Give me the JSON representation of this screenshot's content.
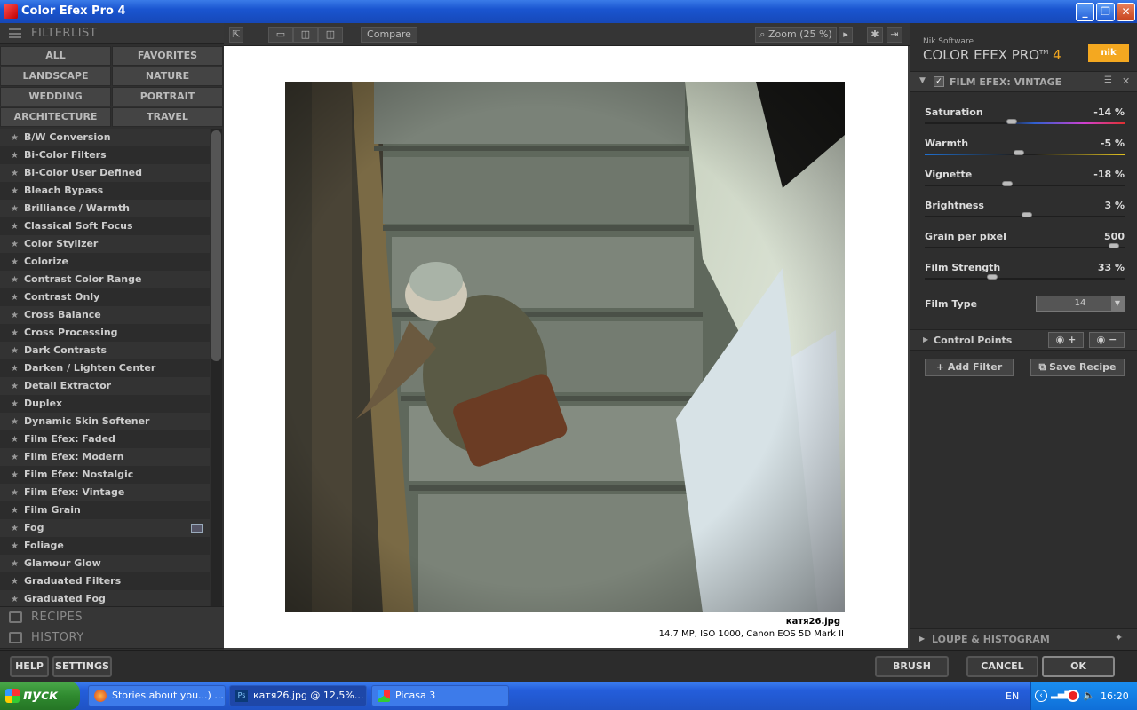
{
  "window": {
    "title": "Color Efex Pro 4"
  },
  "left": {
    "filterlist_label": "FILTERLIST",
    "categories": [
      "ALL",
      "FAVORITES",
      "LANDSCAPE",
      "NATURE",
      "WEDDING",
      "PORTRAIT",
      "ARCHITECTURE",
      "TRAVEL"
    ],
    "filters": [
      "B/W Conversion",
      "Bi-Color Filters",
      "Bi-Color User Defined",
      "Bleach Bypass",
      "Brilliance / Warmth",
      "Classical Soft Focus",
      "Color Stylizer",
      "Colorize",
      "Contrast Color Range",
      "Contrast Only",
      "Cross Balance",
      "Cross Processing",
      "Dark Contrasts",
      "Darken / Lighten Center",
      "Detail Extractor",
      "Duplex",
      "Dynamic Skin Softener",
      "Film Efex: Faded",
      "Film Efex: Modern",
      "Film Efex: Nostalgic",
      "Film Efex: Vintage",
      "Film Grain",
      "Fog",
      "Foliage",
      "Glamour Glow",
      "Graduated Filters",
      "Graduated Fog"
    ],
    "recipes_label": "RECIPES",
    "history_label": "HISTORY"
  },
  "toolbar": {
    "compare": "Compare",
    "zoom": "Zoom (25 %)"
  },
  "image": {
    "filename": "катя26.jpg",
    "meta": "14.7 MP, ISO 1000, Canon EOS 5D Mark II"
  },
  "right": {
    "brand_top": "Nik Software",
    "brand_name": "COLOR EFEX PRO",
    "brand_tm": "TM",
    "brand_version": "4",
    "logo_text": "nik",
    "filter_title": "FILM EFEX: VINTAGE",
    "sliders": [
      {
        "label": "Saturation",
        "value": "-14",
        "unit": "%",
        "pos": 0.43
      },
      {
        "label": "Warmth",
        "value": "-5",
        "unit": "%",
        "pos": 0.47
      },
      {
        "label": "Vignette",
        "value": "-18",
        "unit": "%",
        "pos": 0.41
      },
      {
        "label": "Brightness",
        "value": "3",
        "unit": "%",
        "pos": 0.51
      },
      {
        "label": "Grain per pixel",
        "value": "500",
        "unit": "",
        "pos": 0.97
      },
      {
        "label": "Film Strength",
        "value": "33",
        "unit": "%",
        "pos": 0.33
      }
    ],
    "film_type_label": "Film Type",
    "film_type_value": "14",
    "control_points_label": "Control Points",
    "add_filter": "Add Filter",
    "save_recipe": "Save Recipe",
    "loupe_label": "LOUPE & HISTOGRAM"
  },
  "bottom": {
    "help": "HELP",
    "settings": "SETTINGS",
    "brush": "BRUSH",
    "cancel": "CANCEL",
    "ok": "OK"
  },
  "taskbar": {
    "start": "пуск",
    "tasks": [
      "Stories about you...) ...",
      "катя26.jpg @ 12,5%...",
      "Picasa 3"
    ],
    "lang": "EN",
    "clock": "16:20"
  }
}
